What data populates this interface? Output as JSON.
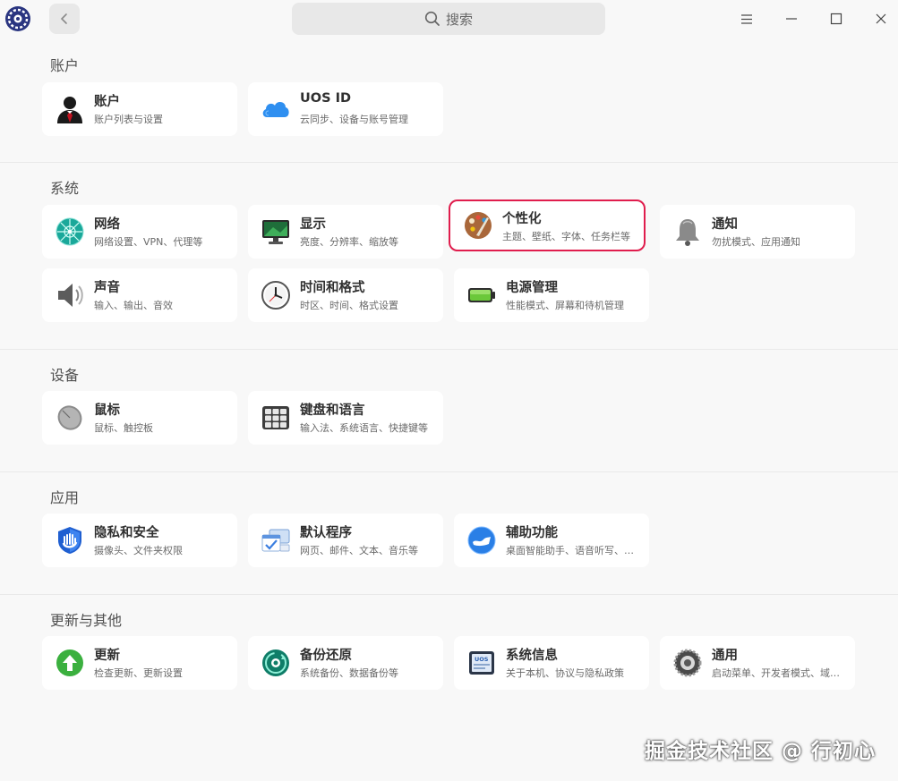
{
  "search": {
    "label": "搜索"
  },
  "sections": {
    "account": {
      "title": "账户",
      "items": [
        {
          "title": "账户",
          "subtitle": "账户列表与设置"
        },
        {
          "title": "UOS ID",
          "subtitle": "云同步、设备与账号管理"
        }
      ]
    },
    "system": {
      "title": "系统",
      "items": [
        {
          "title": "网络",
          "subtitle": "网络设置、VPN、代理等"
        },
        {
          "title": "显示",
          "subtitle": "亮度、分辨率、缩放等"
        },
        {
          "title": "个性化",
          "subtitle": "主题、壁纸、字体、任务栏等"
        },
        {
          "title": "通知",
          "subtitle": "勿扰模式、应用通知"
        },
        {
          "title": "声音",
          "subtitle": "输入、输出、音效"
        },
        {
          "title": "时间和格式",
          "subtitle": "时区、时间、格式设置"
        },
        {
          "title": "电源管理",
          "subtitle": "性能模式、屏幕和待机管理"
        }
      ]
    },
    "devices": {
      "title": "设备",
      "items": [
        {
          "title": "鼠标",
          "subtitle": "鼠标、触控板"
        },
        {
          "title": "键盘和语言",
          "subtitle": "输入法、系统语言、快捷键等"
        }
      ]
    },
    "apps": {
      "title": "应用",
      "items": [
        {
          "title": "隐私和安全",
          "subtitle": "摄像头、文件夹权限"
        },
        {
          "title": "默认程序",
          "subtitle": "网页、邮件、文本、音乐等"
        },
        {
          "title": "辅助功能",
          "subtitle": "桌面智能助手、语音听写、语…"
        }
      ]
    },
    "updates": {
      "title": "更新与其他",
      "items": [
        {
          "title": "更新",
          "subtitle": "检查更新、更新设置"
        },
        {
          "title": "备份还原",
          "subtitle": "系统备份、数据备份等"
        },
        {
          "title": "系统信息",
          "subtitle": "关于本机、协议与隐私政策"
        },
        {
          "title": "通用",
          "subtitle": "启动菜单、开发者模式、域管…"
        }
      ]
    }
  },
  "watermark": "掘金技术社区 @ 行初心",
  "colors": {
    "highlight": "#e01d4d",
    "accent": "#0081ff"
  },
  "icons": {
    "account": "user-avatar-icon",
    "uos_id": "cloud-icon",
    "network": "globe-network-icon",
    "display": "monitor-icon",
    "personalization": "palette-icon",
    "notification": "bell-icon",
    "sound": "speaker-icon",
    "datetime": "clock-icon",
    "power": "battery-icon",
    "mouse": "mouse-icon",
    "keyboard": "keyboard-icon",
    "privacy": "shield-icon",
    "default_apps": "default-apps-icon",
    "accessibility": "accessibility-icon",
    "update": "update-arrow-icon",
    "backup": "backup-restore-icon",
    "system_info": "system-info-icon",
    "general": "gear-icon"
  },
  "uos_badge": "UOS"
}
